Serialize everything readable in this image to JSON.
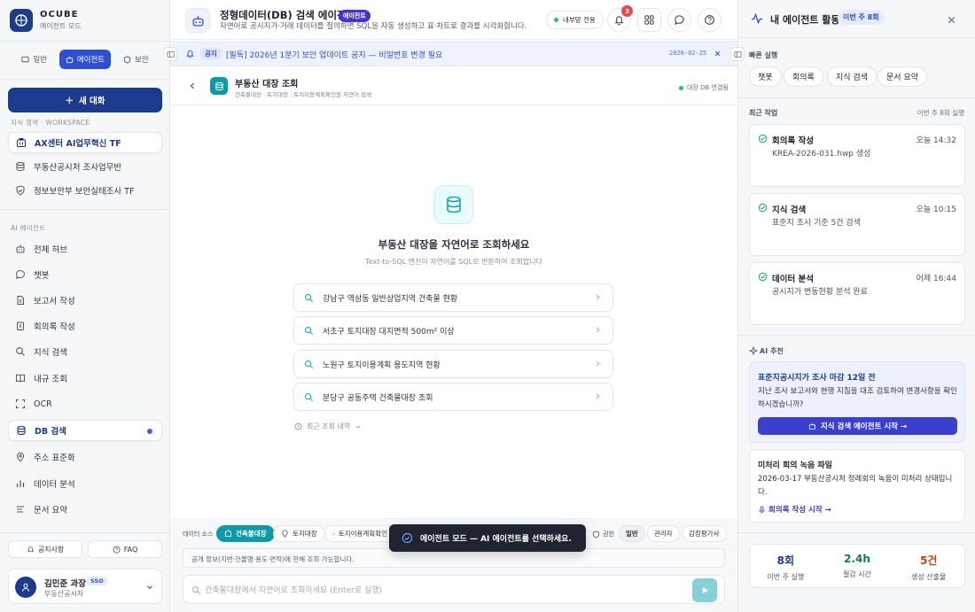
{
  "brand": {
    "name": "OCUBE",
    "sub": "에이전트 모드"
  },
  "modes": [
    {
      "label": "일반",
      "active": false
    },
    {
      "label": "에이전트",
      "active": true
    },
    {
      "label": "보안",
      "active": false
    }
  ],
  "new_chat": "새 대화",
  "workspace": {
    "title": "지식 영역 · WORKSPACE",
    "items": [
      {
        "label": "AX센터 AI업무혁신 TF",
        "active": true
      },
      {
        "label": "부동산공시처 조사업무반",
        "active": false
      },
      {
        "label": "정보보안부 보안실태조사 TF",
        "active": false
      }
    ]
  },
  "agents": {
    "title": "AI 에이전트",
    "items": [
      {
        "label": "전체 허브"
      },
      {
        "label": "챗봇"
      },
      {
        "label": "보고서 작성"
      },
      {
        "label": "회의록 작성"
      },
      {
        "label": "지식 검색"
      },
      {
        "label": "내규 조회"
      },
      {
        "label": "OCR"
      },
      {
        "label": "DB 검색",
        "active": true
      },
      {
        "label": "주소 표준화"
      },
      {
        "label": "데이터 분석"
      },
      {
        "label": "문서 요약"
      }
    ]
  },
  "bottom": {
    "notice": "공지사항",
    "faq": "FAQ"
  },
  "user": {
    "name": "김민준 과장",
    "badge": "SSO",
    "dept": "부동산공시처"
  },
  "header": {
    "title": "정형데이터(DB) 검색 에이전트",
    "badge": "에이전트",
    "subtitle": "자연어로 공시지가·거래 데이터를 질의하면 SQL을 자동 생성하고 표·차트로 결과를 시각화합니다.",
    "network": "내부망 전용",
    "notif_count": "3"
  },
  "notice": {
    "tag": "공지",
    "text": "[필독] 2026년 1분기 보안 업데이트 공지 — 비밀번호 변경 필요",
    "date": "2026-02-25"
  },
  "db": {
    "title": "부동산 대장 조회",
    "sub": "건축물대장 · 토지대장 · 토지이용계획확인원 자연어 검색",
    "status": "대장 DB 연결됨"
  },
  "hero": {
    "title": "부동산 대장을 자연어로 조회하세요",
    "sub": "Text-to-SQL 엔진이 자연어를 SQL로 변환하여 조회합니다"
  },
  "suggestions": [
    "강남구 역삼동 일반상업지역 건축물 현황",
    "서초구 토지대장 대지면적 500m² 이상",
    "노원구 토지이용계획 용도지역 현황",
    "분당구 공동주택 건축물대장 조회"
  ],
  "recent": "최근 조회 내역",
  "composer": {
    "ds_label": "데이터 소스",
    "sources": [
      {
        "label": "건축물대장",
        "active": true
      },
      {
        "label": "토지대장",
        "active": false
      },
      {
        "label": "토지이용계획확인",
        "active": false
      }
    ],
    "perm_label": "권한",
    "perms": [
      {
        "label": "일반",
        "active": true
      },
      {
        "label": "관리자",
        "active": false
      },
      {
        "label": "감정평가사",
        "active": false
      }
    ],
    "hint": "공개 정보(지번·건물명·용도·면적)에 한해 조회 가능합니다.",
    "placeholder": "건축물대장에서 자연어로 조회하세요 (Enter로 실행)"
  },
  "toast": "에이전트 모드 — AI 에이전트를 선택하세요.",
  "panel": {
    "title": "내 에이전트 활동",
    "badge": "이번 주 8회",
    "quick_title": "빠른 실행",
    "quick": [
      "챗봇",
      "회의록",
      "지식 검색",
      "문서 요약"
    ],
    "recent_title": "최근 작업",
    "recent_right": "이번 주 8회 실행",
    "tasks": [
      {
        "name": "회의록 작성",
        "time": "오늘 14:32",
        "desc": "KREA-2026-031.hwp 생성"
      },
      {
        "name": "지식 검색",
        "time": "오늘 10:15",
        "desc": "표준지 조사 기준 5건 검색"
      },
      {
        "name": "데이터 분석",
        "time": "어제 16:44",
        "desc": "공시지가 변동현황 분석 완료"
      }
    ],
    "ai_title": "AI 추천",
    "rec1": {
      "title": "표준지공시지가 조사 마감 12일 전",
      "body": "지난 조사 보고서와 현행 지침을 대조 검토하여 변경사항을 확인하시겠습니까?",
      "button": "지식 검색 에이전트 시작 →"
    },
    "rec2": {
      "title": "미처리 회의 녹음 파일",
      "body": "2026-03-17 부동산공시처 정례회의 녹음이 미처리 상태입니다.",
      "link": "회의록 작성 시작 →"
    },
    "stats": [
      {
        "value": "8회",
        "label": "이번 주 실행",
        "color": "#1c3a8e"
      },
      {
        "value": "2.4h",
        "label": "절감 시간",
        "color": "#157a5a"
      },
      {
        "value": "5건",
        "label": "생성 산출물",
        "color": "#c2410c"
      }
    ]
  }
}
